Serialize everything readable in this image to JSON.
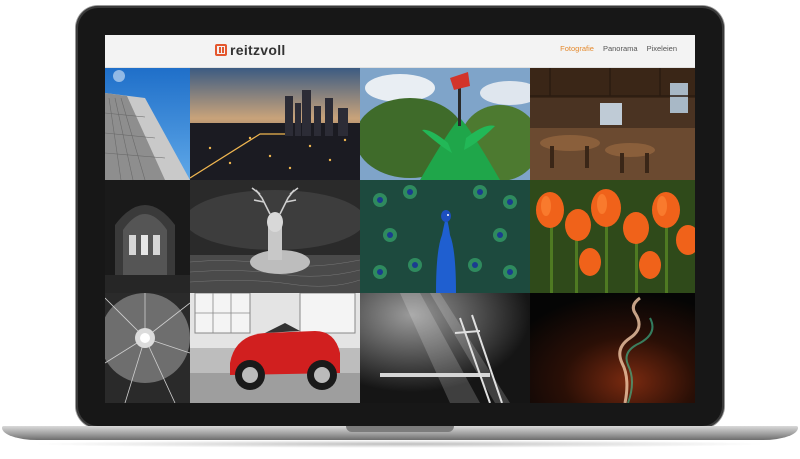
{
  "site": {
    "logo_text": "reitzvoll"
  },
  "nav": {
    "items": [
      {
        "label": "Fotografie",
        "active": true
      },
      {
        "label": "Panorama",
        "active": false
      },
      {
        "label": "Pixeleien",
        "active": false
      }
    ]
  },
  "colors": {
    "accent": "#e58a2e",
    "logo": "#e4572e",
    "header_bg": "#f3f3f3"
  },
  "gallery": {
    "tiles": [
      {
        "subject": "skyscraper-blue-sky"
      },
      {
        "subject": "city-at-dusk"
      },
      {
        "subject": "green-sculpture-trees"
      },
      {
        "subject": "rustic-wooden-interior"
      },
      {
        "subject": "church-arches-bw"
      },
      {
        "subject": "deer-bw"
      },
      {
        "subject": "peacock"
      },
      {
        "subject": "orange-tulips"
      },
      {
        "subject": "dome-ceiling-bw"
      },
      {
        "subject": "red-vintage-car"
      },
      {
        "subject": "forest-light-bw"
      },
      {
        "subject": "smoke"
      }
    ]
  }
}
